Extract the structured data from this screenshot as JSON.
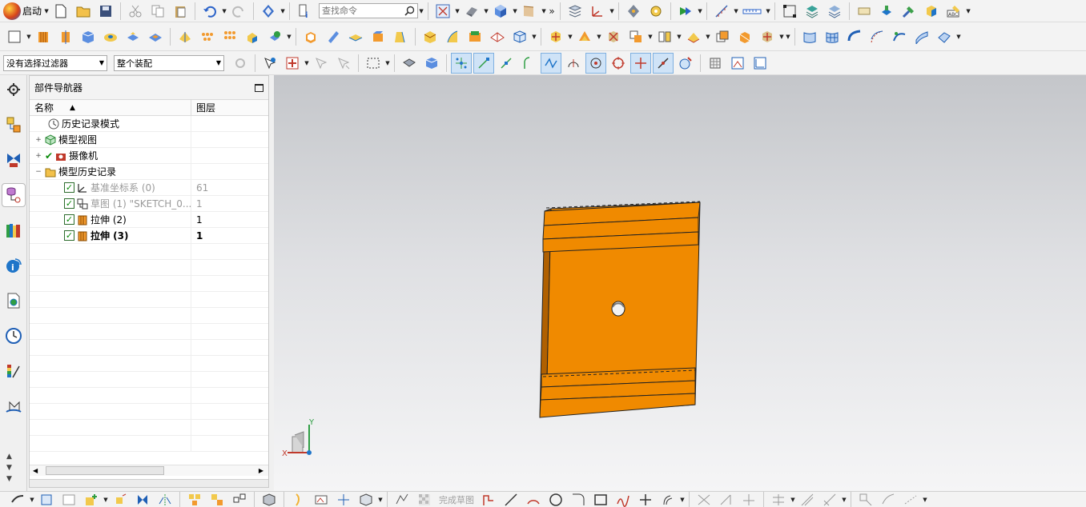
{
  "toolbar": {
    "start_label": "启动",
    "search_placeholder": "查找命令",
    "overflow_glyph": "»"
  },
  "selection_bar": {
    "filter": "没有选择过滤器",
    "scope": "整个装配"
  },
  "navigator": {
    "title": "部件导航器",
    "columns": {
      "name": "名称",
      "layer": "图层"
    },
    "rows": [
      {
        "label": "历史记录模式",
        "layer": ""
      },
      {
        "label": "模型视图",
        "layer": ""
      },
      {
        "label": "摄像机",
        "layer": ""
      },
      {
        "label": "模型历史记录",
        "layer": ""
      },
      {
        "label": "基准坐标系 (0)",
        "layer": "61"
      },
      {
        "label": "草图 (1) \"SKETCH_0...",
        "layer": "1"
      },
      {
        "label": "拉伸 (2)",
        "layer": "1"
      },
      {
        "label": "拉伸 (3)",
        "layer": "1"
      }
    ]
  },
  "viewport": {
    "part_color": "#f08a00",
    "axis_x": "X",
    "axis_y": "Y"
  },
  "bottom_toolbar": {
    "finish_sketch": "完成草图"
  },
  "colors": {
    "accent_blue": "#2a62c9",
    "check_green": "#0a8a0a"
  }
}
